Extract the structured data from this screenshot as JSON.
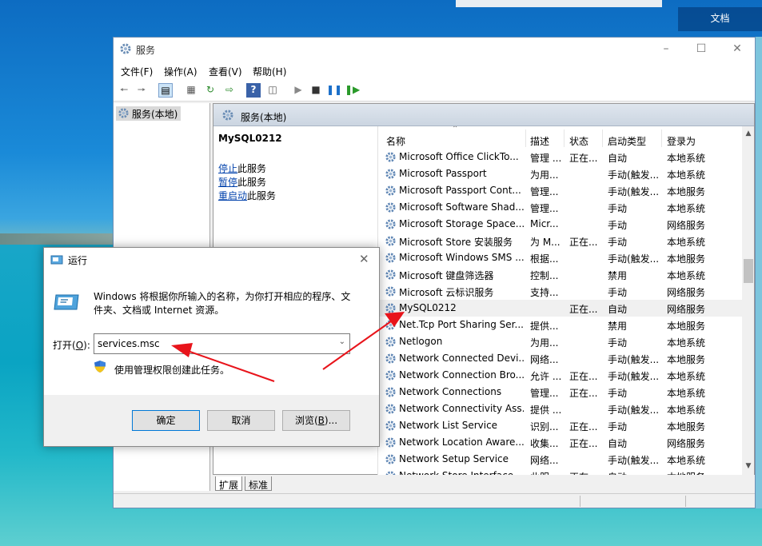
{
  "desktop": {
    "doc_tile": "文档"
  },
  "services_window": {
    "title": "服务",
    "menu": [
      "文件(F)",
      "操作(A)",
      "查看(V)",
      "帮助(H)"
    ],
    "tree_item": "服务(本地)",
    "header": "服务(本地)",
    "selected_service": "MySQL0212",
    "actions": [
      {
        "link": "停止",
        "rest": "此服务"
      },
      {
        "link": "暂停",
        "rest": "此服务"
      },
      {
        "link": "重启动",
        "rest": "此服务"
      }
    ],
    "columns": [
      "名称",
      "描述",
      "状态",
      "启动类型",
      "登录为"
    ],
    "rows": [
      [
        "Microsoft Office ClickTo...",
        "管理 ...",
        "正在...",
        "自动",
        "本地系统"
      ],
      [
        "Microsoft Passport",
        "为用...",
        "",
        "手动(触发...",
        "本地系统"
      ],
      [
        "Microsoft Passport Cont...",
        "管理...",
        "",
        "手动(触发...",
        "本地服务"
      ],
      [
        "Microsoft Software Shad...",
        "管理...",
        "",
        "手动",
        "本地系统"
      ],
      [
        "Microsoft Storage Space...",
        "Micr...",
        "",
        "手动",
        "网络服务"
      ],
      [
        "Microsoft Store 安装服务",
        "为 M...",
        "正在...",
        "手动",
        "本地系统"
      ],
      [
        "Microsoft Windows SMS ...",
        "根据...",
        "",
        "手动(触发...",
        "本地服务"
      ],
      [
        "Microsoft 键盘筛选器",
        "控制...",
        "",
        "禁用",
        "本地系统"
      ],
      [
        "Microsoft 云标识服务",
        "支持...",
        "",
        "手动",
        "网络服务"
      ],
      [
        "MySQL0212",
        "",
        "正在...",
        "自动",
        "网络服务"
      ],
      [
        "Net.Tcp Port Sharing Ser...",
        "提供...",
        "",
        "禁用",
        "本地服务"
      ],
      [
        "Netlogon",
        "为用...",
        "",
        "手动",
        "本地系统"
      ],
      [
        "Network Connected Devi...",
        "网络...",
        "",
        "手动(触发...",
        "本地服务"
      ],
      [
        "Network Connection Bro...",
        "允许 ...",
        "正在...",
        "手动(触发...",
        "本地系统"
      ],
      [
        "Network Connections",
        "管理...",
        "正在...",
        "手动",
        "本地系统"
      ],
      [
        "Network Connectivity Ass...",
        "提供 ...",
        "",
        "手动(触发...",
        "本地系统"
      ],
      [
        "Network List Service",
        "识别...",
        "正在...",
        "手动",
        "本地服务"
      ],
      [
        "Network Location Aware...",
        "收集...",
        "正在...",
        "自动",
        "网络服务"
      ],
      [
        "Network Setup Service",
        "网络...",
        "",
        "手动(触发...",
        "本地系统"
      ],
      [
        "Network Store Interface...",
        "此服...",
        "正在...",
        "自动",
        "本地服务"
      ]
    ],
    "tabs": [
      "扩展",
      "标准"
    ]
  },
  "run_dialog": {
    "title": "运行",
    "description": "Windows 将根据你所输入的名称，为你打开相应的程序、文件夹、文档或 Internet 资源。",
    "open_label_pre": "打开(",
    "open_label_key": "O",
    "open_label_post": "):",
    "input_value": "services.msc",
    "admin_note": "使用管理权限创建此任务。",
    "buttons": {
      "ok": "确定",
      "cancel": "取消",
      "browse_pre": "浏览(",
      "browse_key": "B",
      "browse_post": ")..."
    }
  },
  "colors": {
    "arrow": "#e8141b",
    "link": "#0645ad",
    "selection": "#f0f0f0"
  }
}
